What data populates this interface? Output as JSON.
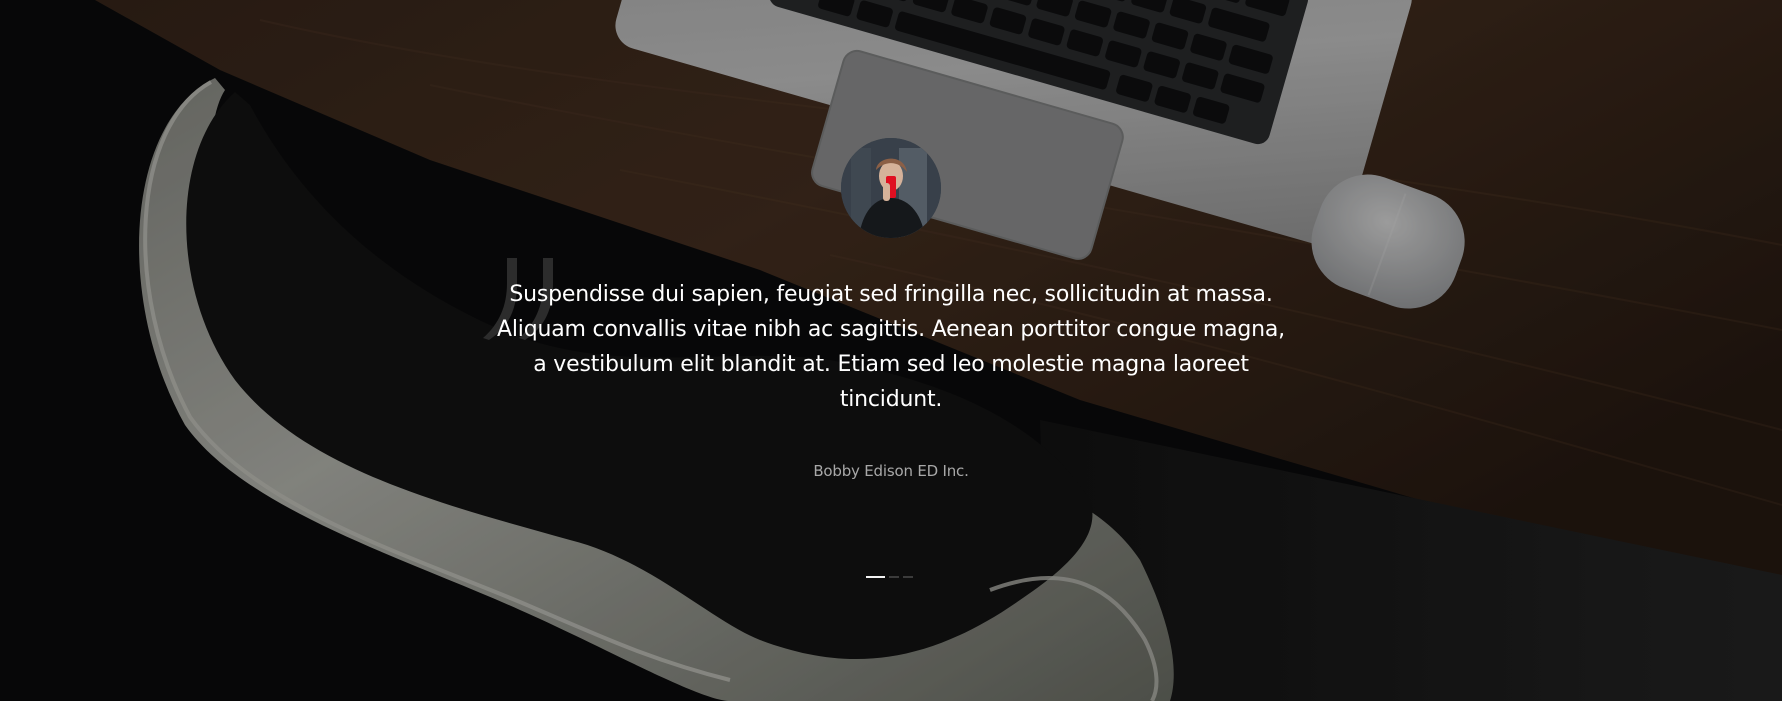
{
  "testimonial": {
    "quote": "Suspendisse dui sapien, feugiat sed fringilla nec, sollicitudin at massa. Aliquam convallis vitae nibh ac sagittis. Aenean porttitor congue magna, a vestibulum elit blandit at. Etiam sed leo molestie magna laoreet tincidunt.",
    "author": "Bobby Edison ED Inc.",
    "active_slide": 1,
    "slide_count": 3
  },
  "colors": {
    "text": "#ffffff",
    "author_text": "#a8a8a8",
    "active_indicator": "#f2f2f2",
    "inactive_indicator": "#3b3b3b"
  },
  "icons": {
    "quote": "quote-icon",
    "avatar": "person-avatar-icon"
  }
}
